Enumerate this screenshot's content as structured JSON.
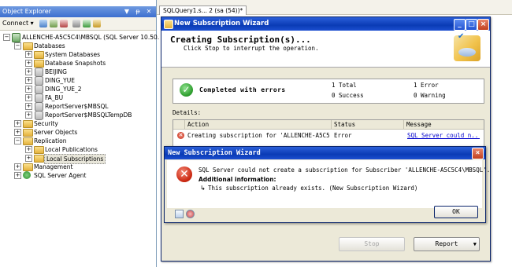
{
  "object_explorer": {
    "title": "Object Explorer",
    "pin_glyph": "▼",
    "pin_glyph2": "ᵽ",
    "close_glyph": "✕",
    "toolbar": {
      "connect_label": "Connect ▾"
    },
    "tree": {
      "server": "ALLENCHE-A5C5C4\\MBSQL (SQL Server 10.50.",
      "databases": "Databases",
      "system_databases": "System Databases",
      "database_snapshots": "Database Snapshots",
      "db1": "BEIJING",
      "db2": "DING_YUE",
      "db3": "DING_YUE_2",
      "db4": "FA_BU",
      "db5": "ReportServer$MBSQL",
      "db6": "ReportServer$MBSQLTempDB",
      "security": "Security",
      "server_objects": "Server Objects",
      "replication": "Replication",
      "local_publications": "Local Publications",
      "local_subscriptions": "Local Subscriptions",
      "management": "Management",
      "sql_server_agent": "SQL Server Agent"
    }
  },
  "background": {
    "query_tab": "SQLQuery1.s... 2 (sa (54))*"
  },
  "wizard": {
    "title": "New Subscription Wizard",
    "heading": "Creating Subscription(s)...",
    "subheading": "Click Stop to interrupt the operation.",
    "status_text": "Completed  with  errors",
    "total": "1 Total",
    "success": "0 Success",
    "error": "1 Error",
    "warning": "0 Warning",
    "details_label": "Details:",
    "columns": {
      "action": "Action",
      "status": "Status",
      "message": "Message"
    },
    "row": {
      "action": "Creating subscription for 'ALLENCHE-A5C5C...",
      "status": "Error",
      "message": "SQL Server could n..."
    },
    "stop_label": "Stop",
    "report_label": "Report",
    "report_arrow": "▼"
  },
  "error_dialog": {
    "title": "New Subscription Wizard",
    "message": "SQL Server could not create a subscription for Subscriber 'ALLENCHE-A5C5C4\\MBSQL'.",
    "additional_label": "Additional information:",
    "arrow": "↳",
    "inner_message": "This subscription already exists. (New Subscription Wizard)",
    "ok_label": "OK"
  },
  "colors": {
    "titlebar_blue": "#0a3bb5",
    "error_red": "#c8230c",
    "success_green": "#2a9a2a",
    "link_blue": "#0000cc"
  }
}
